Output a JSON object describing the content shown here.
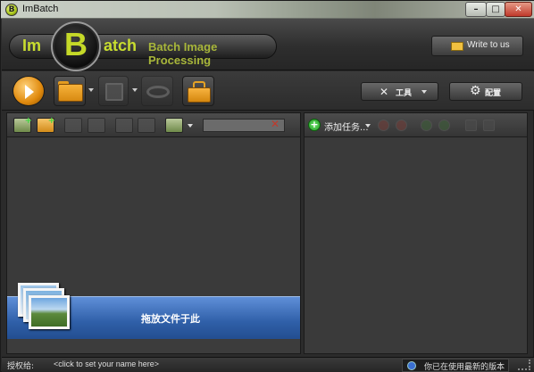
{
  "window": {
    "title": "ImBatch",
    "icon_letter": "B",
    "minimize": "–",
    "maximize": "□",
    "close": "✕"
  },
  "header": {
    "logo_prefix": "Im",
    "logo_letter": "B",
    "logo_suffix": "atch",
    "tagline": "Batch Image Processing",
    "write_label": "Write to us"
  },
  "toolbar": {
    "tools_label": "工具",
    "config_label": "配置"
  },
  "left_panel": {
    "drop_label": "拖放文件于此"
  },
  "right_panel": {
    "add_task_label": "添加任务..."
  },
  "status": {
    "license_label": "授权给:",
    "license_link": "<click to set your name here>",
    "version_text": "你已在使用最新的版本"
  },
  "colors": {
    "accent": "#c8dd2f",
    "drop_zone": "#2f5fa8",
    "background": "#2b2b2b"
  }
}
